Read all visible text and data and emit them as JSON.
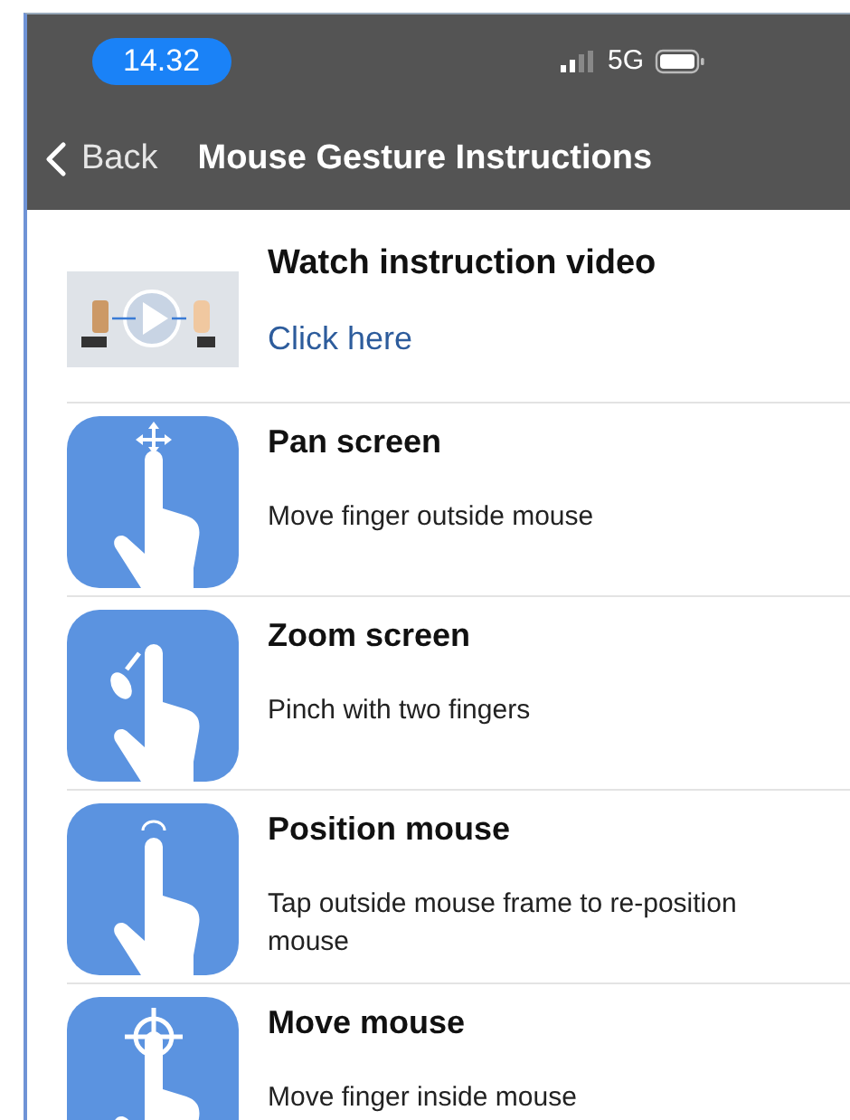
{
  "status_bar": {
    "time": "14.32",
    "network": "5G"
  },
  "nav": {
    "back": "Back",
    "title": "Mouse Gesture Instructions"
  },
  "video": {
    "title": "Watch instruction video",
    "link": "Click here"
  },
  "gestures": [
    {
      "kind": "pan",
      "title": "Pan screen",
      "description": "Move finger outside mouse"
    },
    {
      "kind": "zoom",
      "title": "Zoom screen",
      "description": "Pinch with two fingers"
    },
    {
      "kind": "position",
      "title": "Position mouse",
      "description": "Tap outside mouse frame to re-position mouse"
    },
    {
      "kind": "move",
      "title": "Move mouse",
      "description": "Move finger inside mouse"
    }
  ]
}
